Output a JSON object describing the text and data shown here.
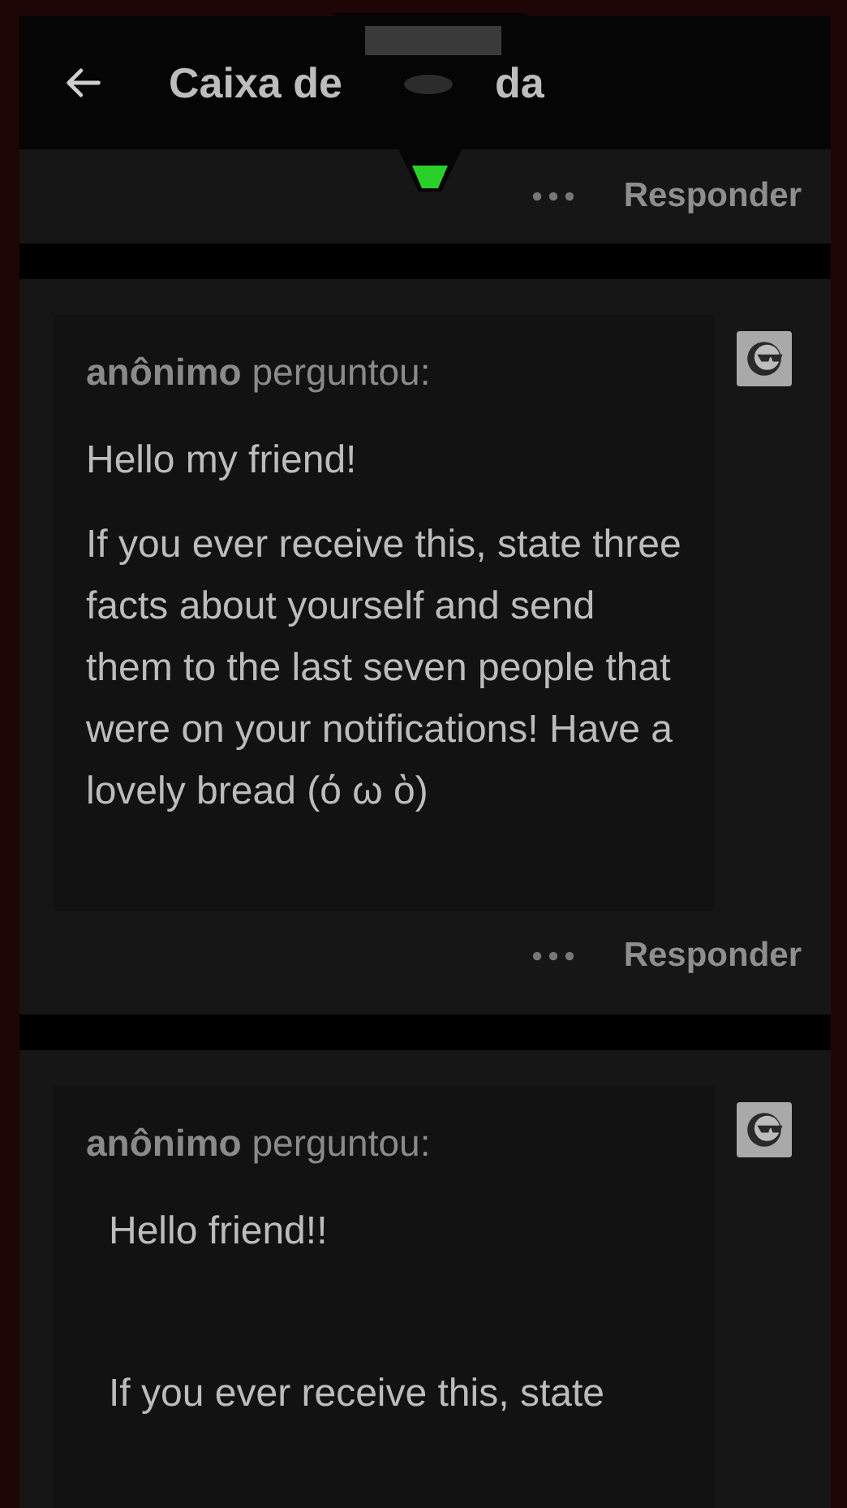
{
  "header": {
    "title_parts": [
      "Caixa de",
      "da"
    ]
  },
  "posts": [
    {
      "kind": "footer",
      "reply": "Responder"
    },
    {
      "kind": "ask",
      "asker": "**anônimo** perguntou:",
      "paragraphs": [
        "Hello my friend!",
        "If you ever receive this, state three facts about yourself and send them to the last seven people that were on your notifications! Have a lovely bread (ό ω ὸ)"
      ],
      "reply": "Responder",
      "indented": false
    },
    {
      "kind": "ask",
      "asker": "**anônimo** perguntou:",
      "paragraphs": [
        "Hello friend!!",
        "If you ever receive this, state"
      ],
      "indented": true
    }
  ]
}
